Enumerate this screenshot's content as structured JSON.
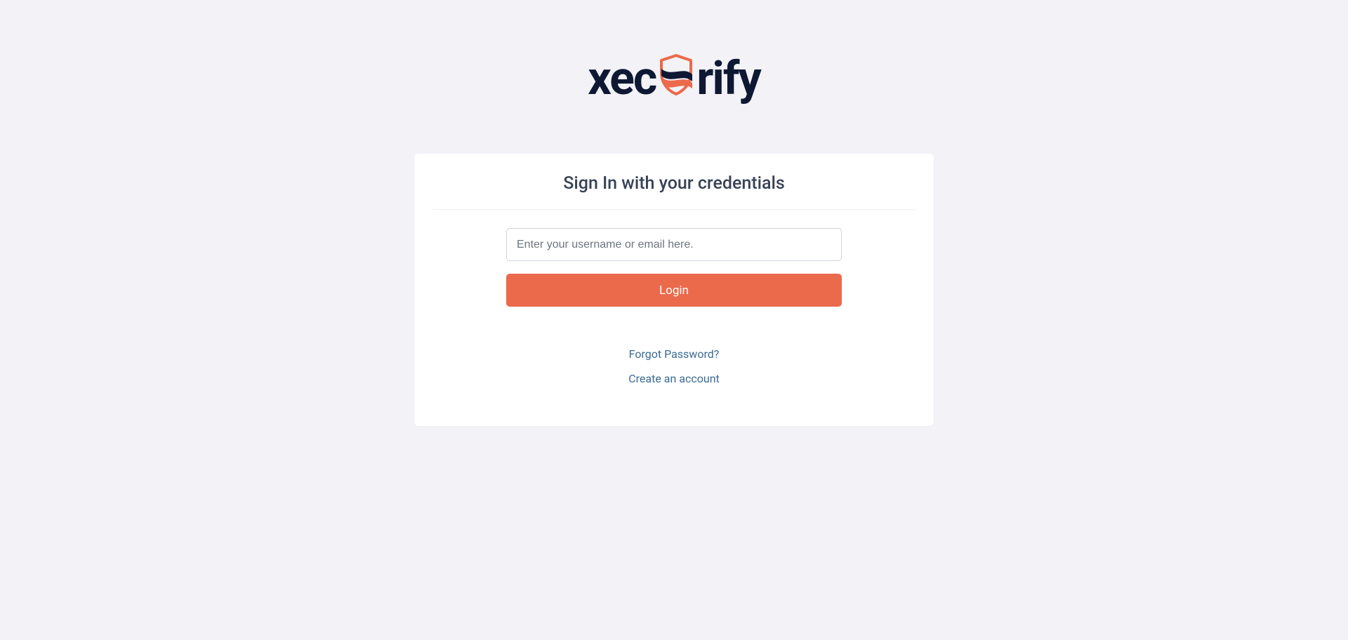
{
  "brand": {
    "name_part1": "xec",
    "name_part2": "rify",
    "accent_color": "#eb6a4b",
    "dark_color": "#0e1833"
  },
  "card": {
    "heading": "Sign In with your credentials"
  },
  "form": {
    "username_placeholder": "Enter your username or email here.",
    "username_value": "",
    "login_button": "Login"
  },
  "links": {
    "forgot_password": "Forgot Password?",
    "create_account": "Create an account"
  }
}
